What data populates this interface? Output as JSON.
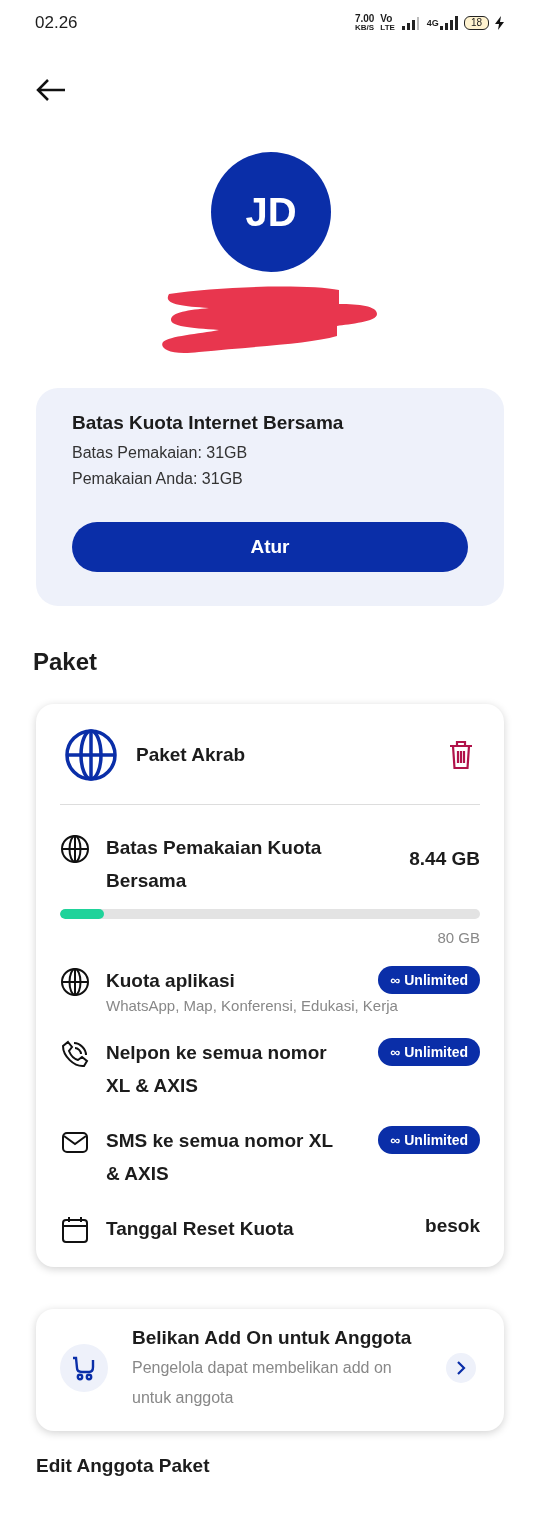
{
  "status_bar": {
    "time": "02.26",
    "net_speed": "7.00",
    "net_unit": "KB/S",
    "volte_top": "Vo",
    "volte_bottom": "LTE",
    "network": "4G",
    "battery": "18"
  },
  "profile": {
    "initials": "JD"
  },
  "quota_card": {
    "title": "Batas Kuota Internet Bersama",
    "lines": [
      "Batas Pemakaian: 31GB",
      "Pemakaian Anda: 31GB"
    ],
    "button": "Atur"
  },
  "section_title": "Paket",
  "package": {
    "name": "Paket Akrab",
    "items": [
      {
        "kind": "quota",
        "title": "Batas Pemakaian Kuota Bersama",
        "value": "8.44 GB",
        "level": 0.105,
        "total": "80 GB"
      },
      {
        "kind": "apps",
        "title": "Kuota aplikasi",
        "subtitle": "WhatsApp, Map, Konferensi, Edukasi, Kerja",
        "badge_symbol": "∞",
        "badge": "Unlimited"
      },
      {
        "kind": "call",
        "title": "Nelpon ke semua nomor XL & AXIS",
        "badge_symbol": "∞",
        "badge": "Unlimited"
      },
      {
        "kind": "sms",
        "title": "SMS ke semua nomor XL & AXIS",
        "badge_symbol": "∞",
        "badge": "Unlimited"
      },
      {
        "kind": "reset",
        "title": "Tanggal Reset Kuota",
        "value": "besok"
      }
    ]
  },
  "addon": {
    "title": "Belikan Add On untuk Anggota",
    "description": "Pengelola dapat membelikan add on untuk anggota"
  },
  "next_section_title": "Edit Anggota Paket"
}
